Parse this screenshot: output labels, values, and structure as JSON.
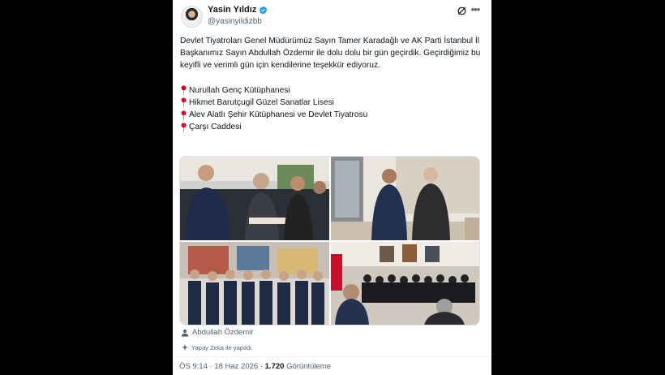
{
  "user": {
    "name": "Yasin Yıldız",
    "handle": "@yasinyildizbb"
  },
  "tweet": {
    "paragraph": "Devlet Tiyatroları Genel Müdürümüz Sayın Tamer Karadağlı ve AK Parti İstanbul İl Başkanımız Sayın Abdullah Özdemir ile dolu dolu bir gün geçirdik. Geçirdiğimiz bu keyifli ve verimli gün için kendilerine teşekkür ediyoruz.",
    "locations": [
      "Nurullah Genç Kütüphanesi",
      "Hikmet Barutçugil Güzel Sanatlar Lisesi",
      "Alev Alatlı Şehir Kütüphanesi ve Devlet Tiyatrosu",
      "Çarşı Caddesi"
    ]
  },
  "tagged_user": "Abdullah Özdemir",
  "ai_label": "Yapay Zeka ile yapıldı",
  "meta": {
    "time": "ÖS 9:14",
    "sep": "·",
    "date": "18 Haz 2026",
    "views_count": "1.720",
    "views_label": "Görüntüleme"
  },
  "icons": [
    "verified-badge-icon",
    "grok-icon",
    "more-icon",
    "location-pin-icon",
    "person-icon",
    "ai-icon"
  ],
  "colors": {
    "verified": "#1d9bf0",
    "pin": "#c8102e",
    "secondary_text": "#536471"
  }
}
